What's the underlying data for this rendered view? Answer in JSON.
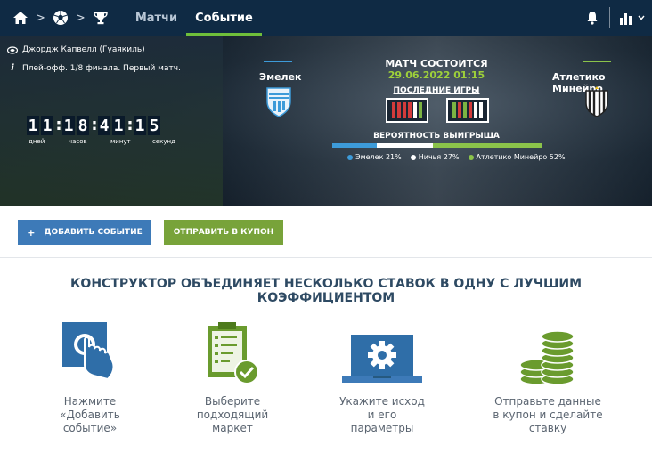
{
  "nav": {
    "tabs": [
      {
        "label": "Матчи",
        "active": false
      },
      {
        "label": "Событие",
        "active": true
      }
    ]
  },
  "match": {
    "venue": "Джордж Капвелл (Гуаякиль)",
    "stage": "Плей-офф. 1/8 финала. Первый матч.",
    "countdown": {
      "digits": [
        "1",
        "1",
        "1",
        "8",
        "4",
        "1",
        "1",
        "5"
      ],
      "labels": [
        "дней",
        "часов",
        "минут",
        "секунд"
      ]
    },
    "title": "МАТЧ СОСТОИТСЯ",
    "date": "29.06.2022 01:15",
    "last_games_label": "ПОСЛЕДНИЕ ИГРЫ",
    "win_prob_label": "ВЕРОЯТНОСТЬ ВЫИГРЫША",
    "home": {
      "name": "Эмелек",
      "color": "#3d9bd9"
    },
    "away": {
      "name": "Атлетико Минейро",
      "color": "#8bc34a"
    },
    "home_form": [
      "#d43b3b",
      "#d43b3b",
      "#d43b3b",
      "#d43b3b",
      "#ffffff",
      "#7cb342"
    ],
    "away_form": [
      "#7cb342",
      "#d43b3b",
      "#7cb342",
      "#d43b3b",
      "#ffffff",
      "#ffffff"
    ],
    "probabilities": [
      {
        "label": "Эмелек 21%",
        "value": 21,
        "color": "#3d9bd9"
      },
      {
        "label": "Ничья 27%",
        "value": 27,
        "color": "#ffffff"
      },
      {
        "label": "Атлетико Минейро 52%",
        "value": 52,
        "color": "#8bc34a"
      }
    ]
  },
  "actions": {
    "add_event": "ДОБАВИТЬ СОБЫТИЕ",
    "add_icon": "+",
    "send_coupon": "ОТПРАВИТЬ В КУПОН"
  },
  "constructor": {
    "title": "КОНСТРУКТОР ОБЪЕДИНЯЕТ НЕСКОЛЬКО СТАВОК В ОДНУ С ЛУЧШИМ КОЭФФИЦИЕНТОМ",
    "steps": [
      {
        "icon": "tap-button-icon",
        "lines": [
          "Нажмите",
          "«Добавить",
          "событие»"
        ]
      },
      {
        "icon": "checklist-icon",
        "lines": [
          "Выберите",
          "подходящий",
          "маркет"
        ]
      },
      {
        "icon": "laptop-gear-icon",
        "lines": [
          "Укажите исход",
          "и его",
          "параметры"
        ]
      },
      {
        "icon": "coins-stack-icon",
        "lines": [
          "Отправьте данные",
          "в купон и сделайте",
          "ставку"
        ]
      }
    ]
  }
}
